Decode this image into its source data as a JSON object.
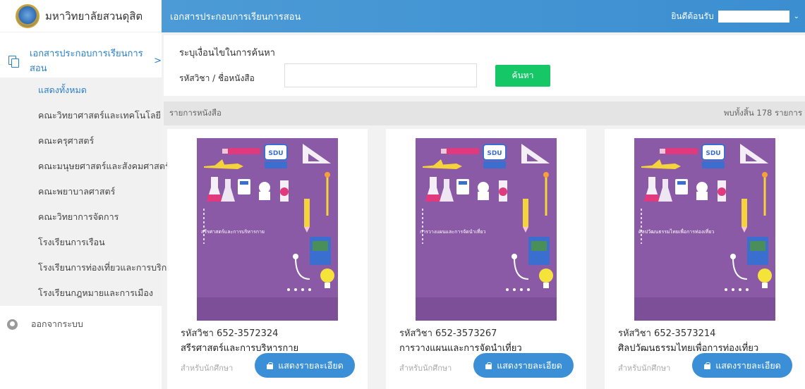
{
  "sidebar": {
    "brand_name": "มหาวิทยาลัยสวนดุสิต",
    "section_label": "เอกสารประกอบการเรียนการสอน",
    "section_chevron": ">",
    "items": [
      {
        "label": "แสดงทั้งหมด"
      },
      {
        "label": "คณะวิทยาศาสตร์และเทคโนโลยี"
      },
      {
        "label": "คณะครุศาสตร์"
      },
      {
        "label": "คณะมนุษยศาสตร์และสังคมศาสตร์"
      },
      {
        "label": "คณะพยาบาลศาสตร์"
      },
      {
        "label": "คณะวิทยาการจัดการ"
      },
      {
        "label": "โรงเรียนการเรือน"
      },
      {
        "label": "โรงเรียนการท่องเที่ยวและการบริการ"
      },
      {
        "label": "โรงเรียนกฎหมายและการเมือง"
      }
    ],
    "logout_label": "ออกจากระบบ"
  },
  "header": {
    "title": "เอกสารประกอบการเรียนการสอน",
    "welcome": "ยินดีต้อนรับ",
    "chevron": "⌄"
  },
  "search": {
    "heading": "ระบุเงื่อนไขในการค้นหา",
    "label": "รหัสวิชา / ชื่อหนังสือ",
    "value": "",
    "button_label": "ค้นหา"
  },
  "list": {
    "heading": "รายการหนังสือ",
    "count_text": "พบทั้งสิ้น 178 รายการ"
  },
  "books": [
    {
      "cover_title": "สรีรศาสตร์และการบริหารกาย",
      "code": "รหัสวิชา 652-3572324",
      "name": "สรีรศาสตร์และการบริหารกาย",
      "audience": "สำหรับนักศึกษา",
      "button_label": "แสดงรายละเอียด"
    },
    {
      "cover_title": "การวางแผนและการจัดนำเที่ยว",
      "code": "รหัสวิชา 652-3573267",
      "name": "การวางแผนและการจัดนำเที่ยว",
      "audience": "สำหรับนักศึกษา",
      "button_label": "แสดงรายละเอียด"
    },
    {
      "cover_title": "ศิลปวัฒนธรรมไทยเพื่อการท่องเที่ยว",
      "code": "รหัสวิชา 652-3573214",
      "name": "ศิลปวัฒนธรรมไทยเพื่อการท่องเที่ยว",
      "audience": "สำหรับนักศึกษา",
      "button_label": "แสดงรายละเอียด"
    }
  ],
  "cover_logo_text": "SDU",
  "colors": {
    "header": "#3b8ed0",
    "accent_blue": "#2a7fc9",
    "search_button": "#16c768",
    "detail_button": "#3a8fd6",
    "cover": "#8a5aa6"
  },
  "icons": {
    "section": "copy-icon",
    "logout": "user-icon",
    "detail_button": "cart-icon"
  }
}
